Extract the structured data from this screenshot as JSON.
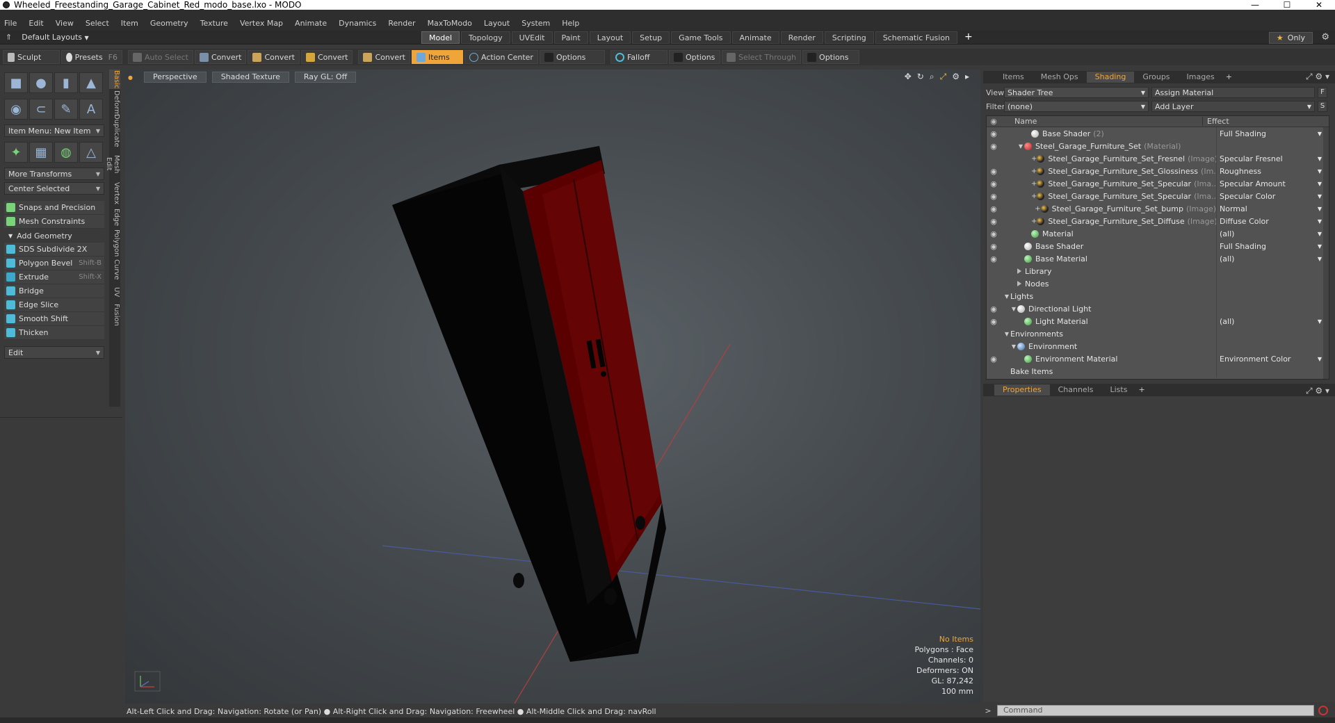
{
  "window": {
    "title": "Wheeled_Freestanding_Garage_Cabinet_Red_modo_base.lxo - MODO",
    "minimize": "—",
    "maximize": "☐",
    "close": "✕"
  },
  "menu": [
    "File",
    "Edit",
    "View",
    "Select",
    "Item",
    "Geometry",
    "Texture",
    "Vertex Map",
    "Animate",
    "Dynamics",
    "Render",
    "MaxToModo",
    "Layout",
    "System",
    "Help"
  ],
  "layoutbar": {
    "layouts_label": "Default Layouts",
    "tabs": [
      "Model",
      "Topology",
      "UVEdit",
      "Paint",
      "Layout",
      "Setup",
      "Game Tools",
      "Animate",
      "Render",
      "Scripting",
      "Schematic Fusion"
    ],
    "active_tab": "Model",
    "plus": "+",
    "only_label": "Only"
  },
  "toolbar": {
    "sculpt": "Sculpt",
    "presets": "Presets",
    "presets_key": "F6",
    "auto_select": "Auto Select",
    "convert1": "Convert",
    "convert2": "Convert",
    "convert3": "Convert",
    "convert4": "Convert",
    "items": "Items",
    "action_center": "Action Center",
    "options1": "Options",
    "falloff": "Falloff",
    "options2": "Options",
    "select_through": "Select Through",
    "options3": "Options"
  },
  "leftpanel": {
    "item_menu": "Item Menu: New Item",
    "more_transforms": "More Transforms",
    "center_selected": "Center Selected",
    "snaps": "Snaps and Precision",
    "mesh_constraints": "Mesh Constraints",
    "add_geometry": "Add Geometry",
    "tools": [
      {
        "label": "SDS Subdivide 2X",
        "key": ""
      },
      {
        "label": "Polygon Bevel",
        "key": "Shift-B"
      },
      {
        "label": "Extrude",
        "key": "Shift-X"
      },
      {
        "label": "Bridge",
        "key": ""
      },
      {
        "label": "Edge Slice",
        "key": ""
      },
      {
        "label": "Smooth Shift",
        "key": ""
      },
      {
        "label": "Thicken",
        "key": ""
      }
    ],
    "edit": "Edit",
    "vtabs": [
      "Basic",
      "Deform",
      "Duplicate",
      "Mesh Edit",
      "Vertex",
      "Edge",
      "Polygon",
      "Curve",
      "UV",
      "Fusion"
    ]
  },
  "viewport": {
    "perspective": "Perspective",
    "shaded": "Shaded Texture",
    "raygl": "Ray GL: Off",
    "info": {
      "no_items": "No Items",
      "polygons": "Polygons : Face",
      "channels": "Channels: 0",
      "deformers": "Deformers: ON",
      "gl": "GL: 87,242",
      "size": "100 mm"
    }
  },
  "statusbar": "Alt-Left Click and Drag: Navigation: Rotate (or Pan) ● Alt-Right Click and Drag: Navigation: Freewheel ● Alt-Middle Click and Drag: navRoll",
  "rightpanel": {
    "tabs": [
      "Items",
      "Mesh Ops",
      "Shading",
      "Groups",
      "Images"
    ],
    "active_tab": "Shading",
    "plus": "+",
    "view_label": "View",
    "view_value": "Shader Tree",
    "assign_material": "Assign Material",
    "f_btn": "F",
    "filter_label": "Filter",
    "filter_value": "(none)",
    "add_layer": "Add Layer",
    "s_btn": "S",
    "col_name": "Name",
    "col_effect": "Effect",
    "tree": [
      {
        "indent": 3,
        "icon": "white",
        "name": "Base Shader",
        "sub": "(2)",
        "effect": "Full Shading",
        "eye": true,
        "arrow": "",
        "plus": false
      },
      {
        "indent": 2,
        "icon": "red",
        "name": "Steel_Garage_Furniture_Set",
        "sub": "(Material)",
        "effect": "",
        "eye": true,
        "arrow": "▼",
        "plus": false
      },
      {
        "indent": 4,
        "icon": "dark",
        "name": "Steel_Garage_Furniture_Set_Fresnel",
        "sub": "(Image)",
        "effect": "Specular Fresnel",
        "eye": false,
        "arrow": "",
        "plus": true
      },
      {
        "indent": 4,
        "icon": "dark",
        "name": "Steel_Garage_Furniture_Set_Glossiness",
        "sub": "(Im...",
        "effect": "Roughness",
        "eye": true,
        "arrow": "",
        "plus": true
      },
      {
        "indent": 4,
        "icon": "dark",
        "name": "Steel_Garage_Furniture_Set_Specular",
        "sub": "(Ima...",
        "effect": "Specular Amount",
        "eye": true,
        "arrow": "",
        "plus": true
      },
      {
        "indent": 4,
        "icon": "dark",
        "name": "Steel_Garage_Furniture_Set_Specular",
        "sub": "(Ima...",
        "effect": "Specular Color",
        "eye": true,
        "arrow": "",
        "plus": true
      },
      {
        "indent": 4,
        "icon": "dark",
        "name": "Steel_Garage_Furniture_Set_bump",
        "sub": "(Image)",
        "effect": "Normal",
        "eye": true,
        "arrow": "",
        "plus": true
      },
      {
        "indent": 4,
        "icon": "dark",
        "name": "Steel_Garage_Furniture_Set_Diffuse",
        "sub": "(Image)",
        "effect": "Diffuse Color",
        "eye": true,
        "arrow": "",
        "plus": true
      },
      {
        "indent": 3,
        "icon": "green",
        "name": "Material",
        "sub": "",
        "effect": "(all)",
        "eye": true,
        "arrow": "",
        "plus": false
      },
      {
        "indent": 2,
        "icon": "white",
        "name": "Base Shader",
        "sub": "",
        "effect": "Full Shading",
        "eye": true,
        "arrow": "",
        "plus": false
      },
      {
        "indent": 2,
        "icon": "green",
        "name": "Base Material",
        "sub": "",
        "effect": "(all)",
        "eye": true,
        "arrow": "",
        "plus": false
      },
      {
        "indent": 1,
        "icon": "folder",
        "name": "Library",
        "sub": "",
        "effect": "",
        "eye": false,
        "arrow": "",
        "plus": false
      },
      {
        "indent": 1,
        "icon": "folder",
        "name": "Nodes",
        "sub": "",
        "effect": "",
        "eye": false,
        "arrow": "",
        "plus": false
      },
      {
        "indent": 0,
        "icon": "",
        "name": "Lights",
        "sub": "",
        "effect": "",
        "eye": false,
        "arrow": "▼",
        "plus": false
      },
      {
        "indent": 1,
        "icon": "white",
        "name": "Directional Light",
        "sub": "",
        "effect": "",
        "eye": true,
        "arrow": "▼",
        "plus": false
      },
      {
        "indent": 2,
        "icon": "green",
        "name": "Light Material",
        "sub": "",
        "effect": "(all)",
        "eye": true,
        "arrow": "",
        "plus": false
      },
      {
        "indent": 0,
        "icon": "",
        "name": "Environments",
        "sub": "",
        "effect": "",
        "eye": false,
        "arrow": "▼",
        "plus": false
      },
      {
        "indent": 1,
        "icon": "blue",
        "name": "Environment",
        "sub": "",
        "effect": "",
        "eye": false,
        "arrow": "▼",
        "plus": false
      },
      {
        "indent": 2,
        "icon": "green",
        "name": "Environment Material",
        "sub": "",
        "effect": "Environment Color",
        "eye": true,
        "arrow": "",
        "plus": false
      },
      {
        "indent": 0,
        "icon": "",
        "name": "Bake Items",
        "sub": "",
        "effect": "",
        "eye": false,
        "arrow": "",
        "plus": false
      }
    ],
    "prop_tabs": [
      "Properties",
      "Channels",
      "Lists"
    ],
    "prop_active": "Properties",
    "command_placeholder": "Command"
  },
  "colors": {
    "accent": "#f0a53a",
    "cabinet_red": "#5a0000",
    "cabinet_black": "#050505"
  }
}
